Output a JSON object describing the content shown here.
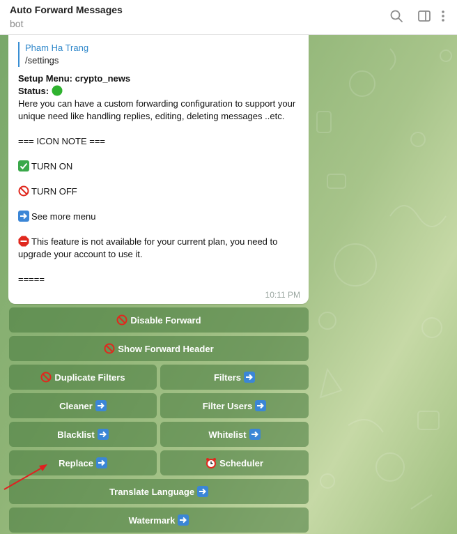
{
  "header": {
    "title": "Auto Forward Messages",
    "subtitle": "bot",
    "icons": [
      "search-icon",
      "sidebar-toggle-icon",
      "more-vertical-icon"
    ]
  },
  "message": {
    "reply_to": {
      "name": "Pham Ha Trang",
      "text": "/settings"
    },
    "setup_menu": "Setup Menu: crypto_news",
    "status_label": "Status:",
    "status_icon": "green-circle",
    "intro": "Here you can have a custom forwarding configuration to support your unique need like handling replies, editing, deleting messages ..etc.",
    "icon_note": "=== ICON NOTE ===",
    "notes": [
      {
        "icon": "check-green-icon",
        "text": "TURN ON"
      },
      {
        "icon": "no-entry-icon",
        "text": "TURN OFF"
      },
      {
        "icon": "arrow-right-icon",
        "text": "See more menu"
      },
      {
        "icon": "stop-sign-icon",
        "text": "This feature is not available for your current plan, you need to upgrade your account to use it."
      }
    ],
    "footer_line": "=====",
    "time": "10:11 PM"
  },
  "buttons": {
    "disable_forward": "Disable Forward",
    "show_forward_header": "Show Forward Header",
    "duplicate_filters": "Duplicate Filters",
    "filters": "Filters",
    "cleaner": "Cleaner",
    "filter_users": "Filter Users",
    "blacklist": "Blacklist",
    "whitelist": "Whitelist",
    "replace": "Replace",
    "scheduler": "Scheduler",
    "translate_language": "Translate Language",
    "watermark": "Watermark"
  },
  "colors": {
    "accent_blue": "#2e87ca",
    "button_bg": "rgba(70,120,60,0.55)",
    "annotation_red": "#e02020"
  }
}
